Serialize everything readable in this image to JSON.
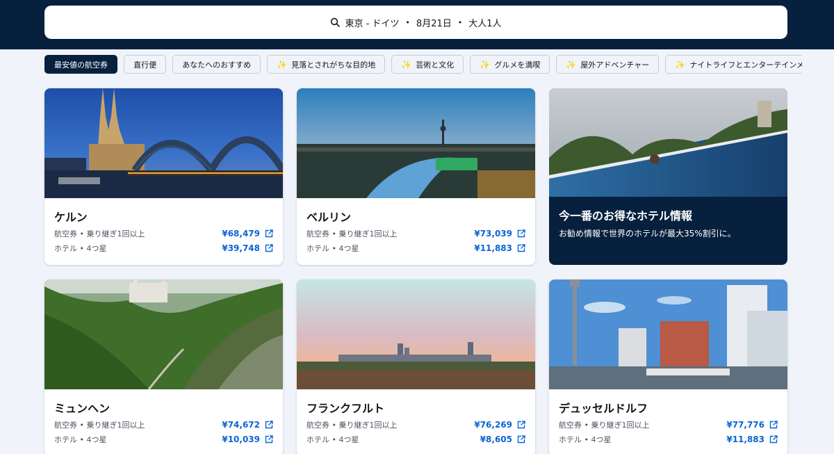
{
  "search": {
    "route": "東京 - ドイツ",
    "date": "8月21日",
    "travelers": "大人1人",
    "separator": "•"
  },
  "filters": [
    {
      "label": "最安値の航空券",
      "active": true,
      "sparkle": false
    },
    {
      "label": "直行便",
      "active": false,
      "sparkle": false
    },
    {
      "label": "あなたへのおすすめ",
      "active": false,
      "sparkle": false
    },
    {
      "label": "見落とされがちな目的地",
      "active": false,
      "sparkle": true
    },
    {
      "label": "芸術と文化",
      "active": false,
      "sparkle": true
    },
    {
      "label": "グルメを満喫",
      "active": false,
      "sparkle": true
    },
    {
      "label": "屋外アドベンチャー",
      "active": false,
      "sparkle": true
    },
    {
      "label": "ナイトライフとエンターテインメント",
      "active": false,
      "sparkle": true
    }
  ],
  "sparkle_glyph": "✨",
  "cards": [
    {
      "city": "ケルン",
      "flight_label": "航空券",
      "flight_detail": "乗り継ぎ1回以上",
      "flight_price": "¥68,479",
      "hotel_label": "ホテル",
      "hotel_detail": "4つ星",
      "hotel_price": "¥39,748",
      "image_icon": "cologne-cathedral-bridge-night"
    },
    {
      "city": "ベルリン",
      "flight_label": "航空券",
      "flight_detail": "乗り継ぎ1回以上",
      "flight_price": "¥73,039",
      "hotel_label": "ホテル",
      "hotel_detail": "4つ星",
      "hotel_price": "¥11,883",
      "image_icon": "berlin-skyline-dusk"
    },
    {
      "city": "ミュンヘン",
      "flight_label": "航空券",
      "flight_detail": "乗り継ぎ1回以上",
      "flight_price": "¥74,672",
      "hotel_label": "ホテル",
      "hotel_detail": "4つ星",
      "hotel_price": "¥10,039",
      "image_icon": "neuschwanstein-castle-valley"
    },
    {
      "city": "フランクフルト",
      "flight_label": "航空券",
      "flight_detail": "乗り継ぎ1回以上",
      "flight_price": "¥76,269",
      "hotel_label": "ホテル",
      "hotel_detail": "4つ星",
      "hotel_price": "¥8,605",
      "image_icon": "frankfurt-skyline-field"
    },
    {
      "city": "デュッセルドルフ",
      "flight_label": "航空券",
      "flight_detail": "乗り継ぎ1回以上",
      "flight_price": "¥77,776",
      "hotel_label": "ホテル",
      "hotel_detail": "4つ星",
      "hotel_price": "¥11,883",
      "image_icon": "dusseldorf-rhine-tower-harbour"
    }
  ],
  "promo": {
    "title": "今一番のお得なホテル情報",
    "subtitle": "お勧め情報で世界のホテルが最大35%割引に。",
    "image_icon": "infinity-pool"
  },
  "colors": {
    "header_bg": "#06203d",
    "page_bg": "#f0f3f9",
    "price": "#0b63d6",
    "sparkle": "#f2b51f"
  }
}
